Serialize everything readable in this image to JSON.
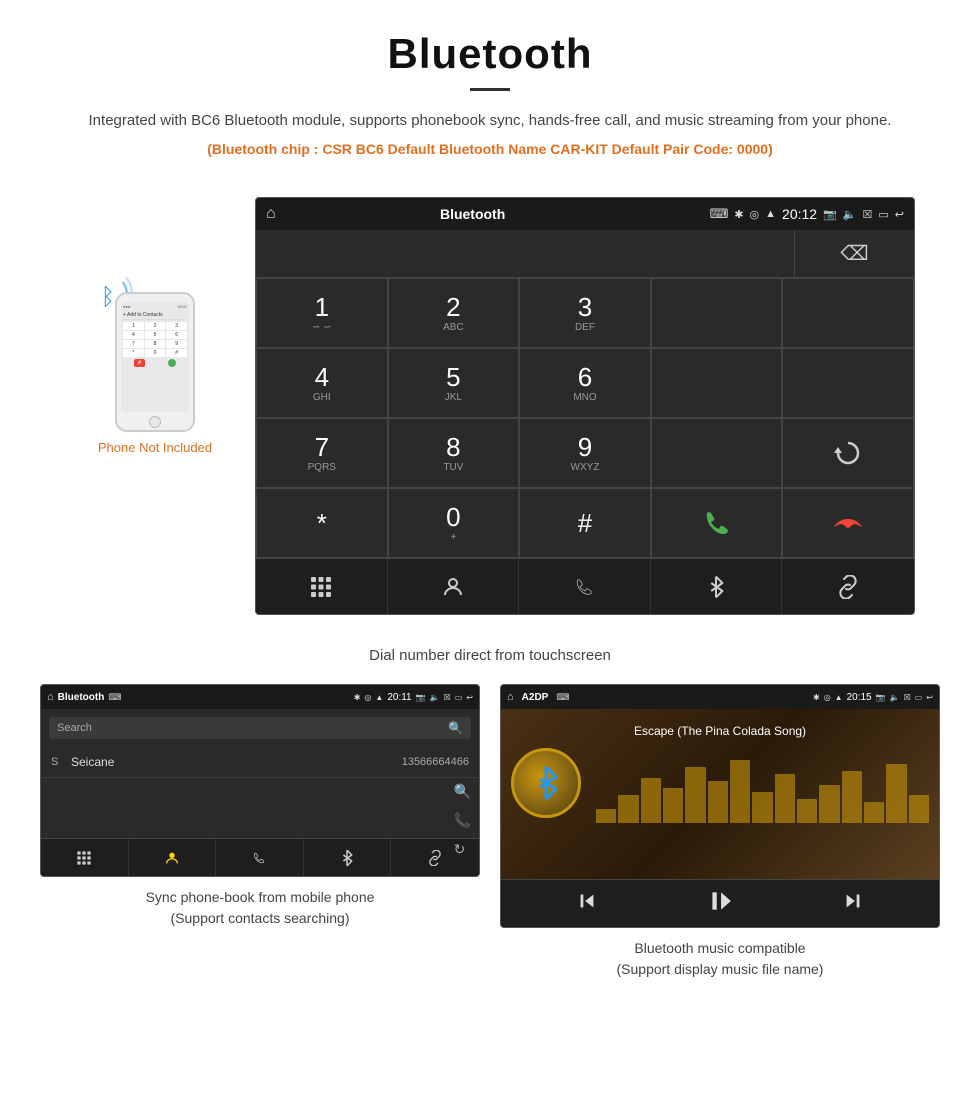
{
  "header": {
    "title": "Bluetooth",
    "description": "Integrated with BC6 Bluetooth module, supports phonebook sync, hands-free call, and music streaming from your phone.",
    "specs": "(Bluetooth chip : CSR BC6    Default Bluetooth Name CAR-KIT    Default Pair Code: 0000)"
  },
  "dial_screen": {
    "status_title": "Bluetooth",
    "status_time": "20:12",
    "status_usb": "⌨",
    "keys": [
      {
        "num": "1",
        "sub": "∽ ∽"
      },
      {
        "num": "2",
        "sub": "ABC"
      },
      {
        "num": "3",
        "sub": "DEF"
      },
      {
        "num": "",
        "sub": ""
      },
      {
        "num": "⌫",
        "sub": ""
      },
      {
        "num": "4",
        "sub": "GHI"
      },
      {
        "num": "5",
        "sub": "JKL"
      },
      {
        "num": "6",
        "sub": "MNO"
      },
      {
        "num": "",
        "sub": ""
      },
      {
        "num": "",
        "sub": ""
      },
      {
        "num": "7",
        "sub": "PQRS"
      },
      {
        "num": "8",
        "sub": "TUV"
      },
      {
        "num": "9",
        "sub": "WXYZ"
      },
      {
        "num": "",
        "sub": ""
      },
      {
        "num": "↻",
        "sub": ""
      },
      {
        "num": "*",
        "sub": ""
      },
      {
        "num": "0",
        "sub": "+"
      },
      {
        "num": "#",
        "sub": ""
      },
      {
        "num": "📞",
        "sub": ""
      },
      {
        "num": "📵",
        "sub": ""
      }
    ]
  },
  "dial_caption": "Dial number direct from touchscreen",
  "phonebook_screen": {
    "status_title": "Bluetooth",
    "status_time": "20:11",
    "search_placeholder": "Search",
    "contact": {
      "letter": "S",
      "name": "Seicane",
      "number": "13566664466"
    }
  },
  "phonebook_caption_line1": "Sync phone-book from mobile phone",
  "phonebook_caption_line2": "(Support contacts searching)",
  "music_screen": {
    "status_title": "A2DP",
    "status_time": "20:15",
    "song_title": "Escape (The Pina Colada Song)"
  },
  "music_caption_line1": "Bluetooth music compatible",
  "music_caption_line2": "(Support display music file name)",
  "phone_not_included": "Phone Not Included",
  "nav_icons": {
    "grid": "⊞",
    "person": "👤",
    "phone": "📞",
    "bluetooth": "Ɓ",
    "link": "🔗"
  }
}
